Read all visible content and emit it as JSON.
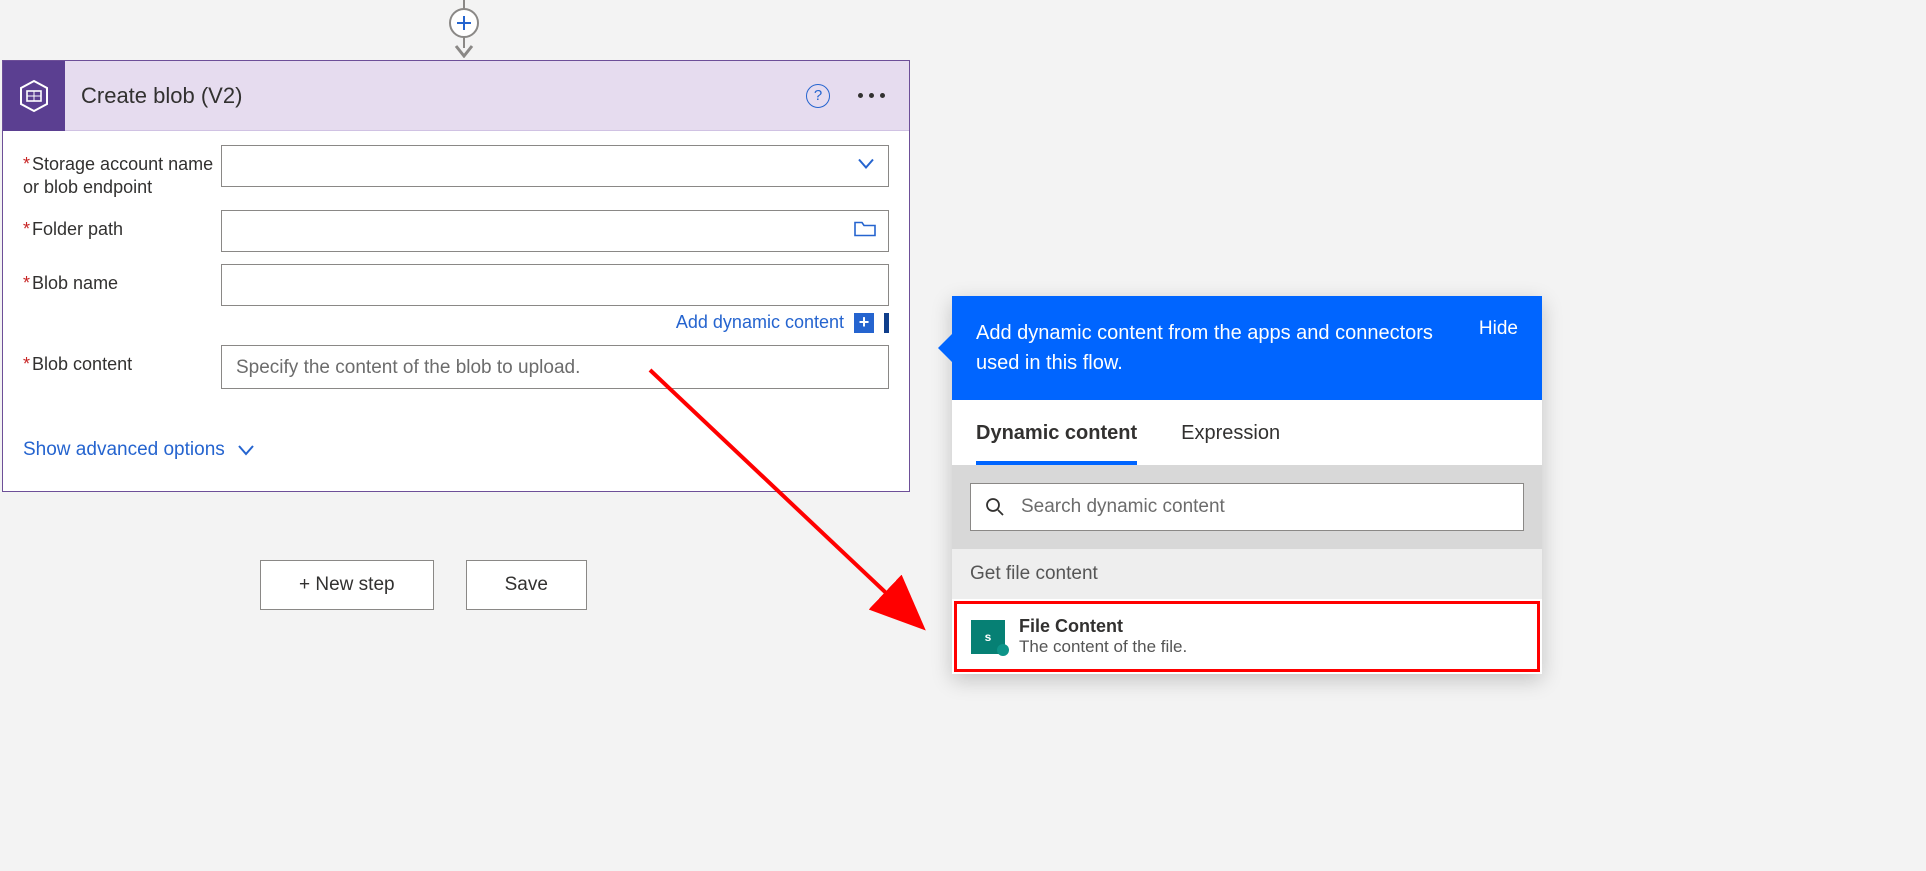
{
  "card": {
    "title": "Create blob (V2)",
    "fields": {
      "storage_account": {
        "label": "Storage account name or blob endpoint"
      },
      "folder_path": {
        "label": "Folder path"
      },
      "blob_name": {
        "label": "Blob name"
      },
      "blob_content": {
        "label": "Blob content",
        "placeholder": "Specify the content of the blob to upload."
      }
    },
    "dynamic_link": "Add dynamic content",
    "advanced": "Show advanced options"
  },
  "buttons": {
    "new_step": "+ New step",
    "save": "Save"
  },
  "popup": {
    "headline": "Add dynamic content from the apps and connectors used in this flow.",
    "hide": "Hide",
    "tabs": {
      "dynamic": "Dynamic content",
      "expression": "Expression"
    },
    "search_placeholder": "Search dynamic content",
    "section": "Get file content",
    "item": {
      "title": "File Content",
      "subtitle": "The content of the file."
    }
  }
}
